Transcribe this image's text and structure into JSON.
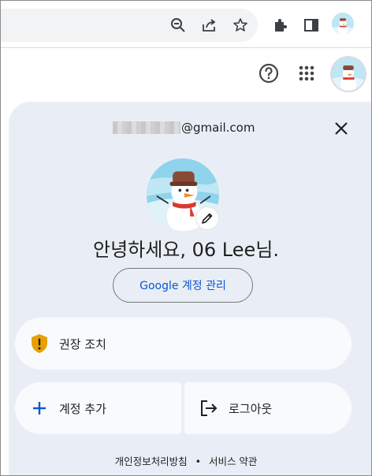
{
  "browser": {
    "toolbar_icons": [
      "zoom-out-icon",
      "share-icon",
      "star-icon",
      "extensions-icon",
      "side-panel-icon",
      "profile-avatar"
    ]
  },
  "header": {
    "icons": [
      "help-icon",
      "apps-grid-icon",
      "account-avatar"
    ]
  },
  "account": {
    "email_suffix": "@gmail.com",
    "greeting": "안녕하세요, 06 Lee님.",
    "manage_label": "Google 계정 관리"
  },
  "actions": {
    "recommended_label": "권장 조치",
    "add_account_label": "계정 추가",
    "logout_label": "로그아웃"
  },
  "footer": {
    "privacy_label": "개인정보처리방침",
    "separator": "•",
    "terms_label": "서비스 약관"
  },
  "colors": {
    "panel_bg": "#e9eef6",
    "card_bg": "#f8fafd",
    "accent_blue": "#0b57d0",
    "warning": "#e8a000"
  }
}
